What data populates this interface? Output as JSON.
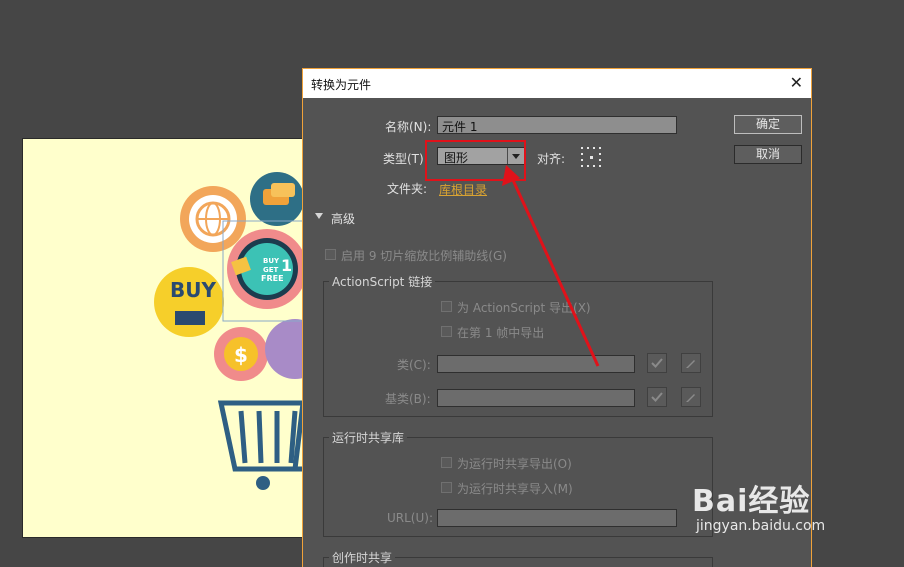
{
  "dialog": {
    "title": "转换为元件",
    "name_label": "名称(N):",
    "name_value": "元件 1",
    "type_label": "类型(T)",
    "type_value": "图形",
    "align_label": "对齐:",
    "folder_label": "文件夹:",
    "folder_link": "库根目录",
    "advanced_label": "高级",
    "nine_slice_label": "启用 9 切片缩放比例辅助线(G)",
    "ok_label": "确定",
    "cancel_label": "取消",
    "actionscript": {
      "group_label": "ActionScript 链接",
      "export_as_label": "为 ActionScript 导出(X)",
      "frame1_label": "在第 1 帧中导出",
      "class_label": "类(C):",
      "base_label": "基类(B):"
    },
    "runtime": {
      "group_label": "运行时共享库",
      "export_label": "为运行时共享导出(O)",
      "import_label": "为运行时共享导入(M)",
      "url_label": "URL(U):"
    },
    "authortime_label": "创作时共享"
  },
  "artwork": {
    "buy_text": "BUY",
    "badge_line1": "BUY",
    "badge_line2": "GET",
    "badge_line3": "FREE",
    "badge_number": "1",
    "dollar": "$"
  },
  "watermark": {
    "brand": "Bai经验",
    "sub": "jingyan.baidu.com"
  },
  "colors": {
    "accent_orange": "#f0a23a",
    "highlight_red": "#e0121a",
    "link_gold": "#d9a332"
  }
}
